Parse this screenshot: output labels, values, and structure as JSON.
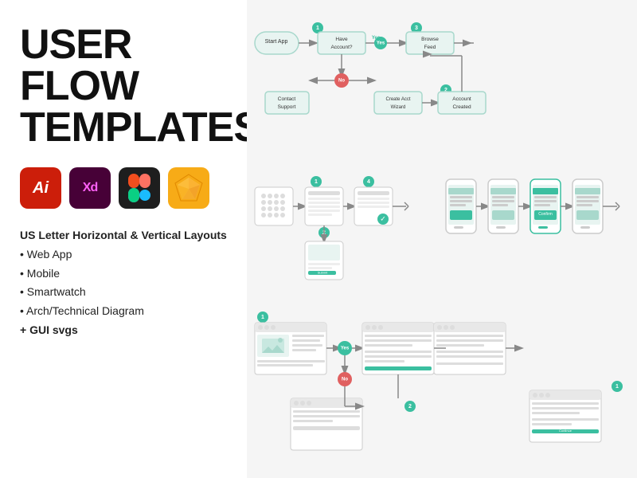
{
  "left": {
    "title_line1": "USER FLOW",
    "title_line2": "TEMPLATES",
    "tools": [
      {
        "id": "ai",
        "label": "Ai",
        "bg": "#cc1e0a"
      },
      {
        "id": "xd",
        "label": "Xd",
        "bg": "#470137"
      },
      {
        "id": "figma",
        "label": "Figma",
        "bg": "#1e1e1e"
      },
      {
        "id": "sketch",
        "label": "Sketch",
        "bg": "#f7ab17"
      }
    ],
    "features": {
      "layout": "US Letter Horizontal & Vertical Layouts",
      "bullets": [
        "• Web App",
        "• Mobile",
        "• Smartwatch",
        "• Arch/Technical Diagram",
        "+ GUI svgs"
      ]
    }
  },
  "diagram": {
    "colors": {
      "teal": "#3bbfa0",
      "red": "#e06060",
      "node_fill": "#e8f4f1",
      "node_stroke": "#a8d8cc",
      "arrow": "#888888"
    }
  }
}
